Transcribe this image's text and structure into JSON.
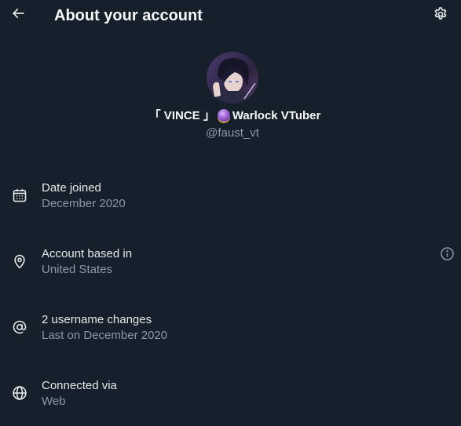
{
  "header": {
    "title": "About your account",
    "back_icon": "arrow-left-icon",
    "settings_icon": "gear-icon"
  },
  "profile": {
    "display_name_left": "「 VINCE 」",
    "display_name_emoji": "crystal-ball-icon",
    "display_name_right": "Warlock VTuber",
    "handle": "@faust_vt"
  },
  "details": [
    {
      "icon": "calendar-icon",
      "label": "Date joined",
      "value": "December 2020"
    },
    {
      "icon": "location-pin-icon",
      "label": "Account based in",
      "value": "United States",
      "info_icon": "info-icon"
    },
    {
      "icon": "at-sign-icon",
      "label": "2 username changes",
      "value": "Last on December 2020"
    },
    {
      "icon": "globe-icon",
      "label": "Connected via",
      "value": "Web"
    }
  ],
  "colors": {
    "background": "#15202b",
    "primary_text": "#e7e9ea",
    "secondary_text": "#8b98a5"
  }
}
